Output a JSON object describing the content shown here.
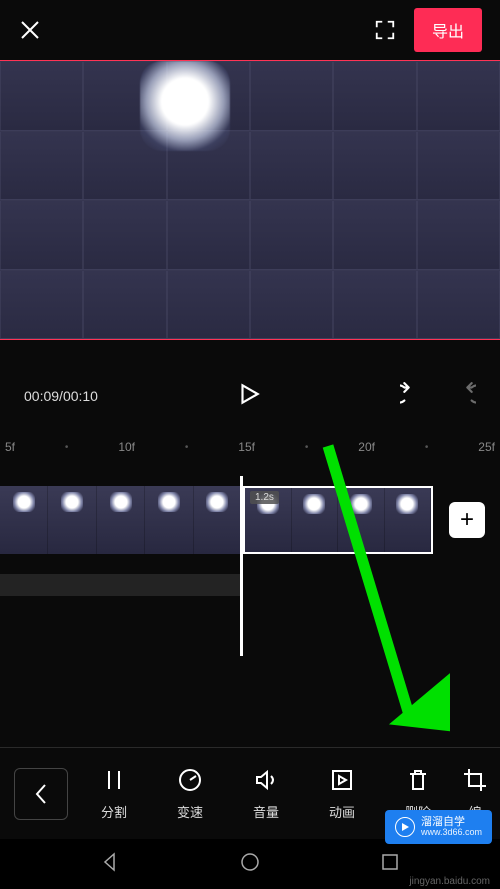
{
  "header": {
    "export_label": "导出"
  },
  "playback": {
    "current_time": "00:09",
    "total_time": "00:10"
  },
  "ruler": {
    "marks": [
      "5f",
      "10f",
      "15f",
      "20f",
      "25f"
    ]
  },
  "timeline": {
    "selected_clip_duration": "1.2s"
  },
  "toolbar": {
    "items": [
      {
        "id": "split",
        "label": "分割"
      },
      {
        "id": "speed",
        "label": "变速"
      },
      {
        "id": "volume",
        "label": "音量"
      },
      {
        "id": "animation",
        "label": "动画"
      },
      {
        "id": "delete",
        "label": "删除"
      },
      {
        "id": "crop",
        "label": "编"
      }
    ]
  },
  "watermark": {
    "title": "溜溜自学",
    "url": "www.3d66.com"
  },
  "footer_credit": "jingyan.baidu.com",
  "annotation": {
    "arrow_color": "#00e000",
    "points_to": "delete"
  }
}
